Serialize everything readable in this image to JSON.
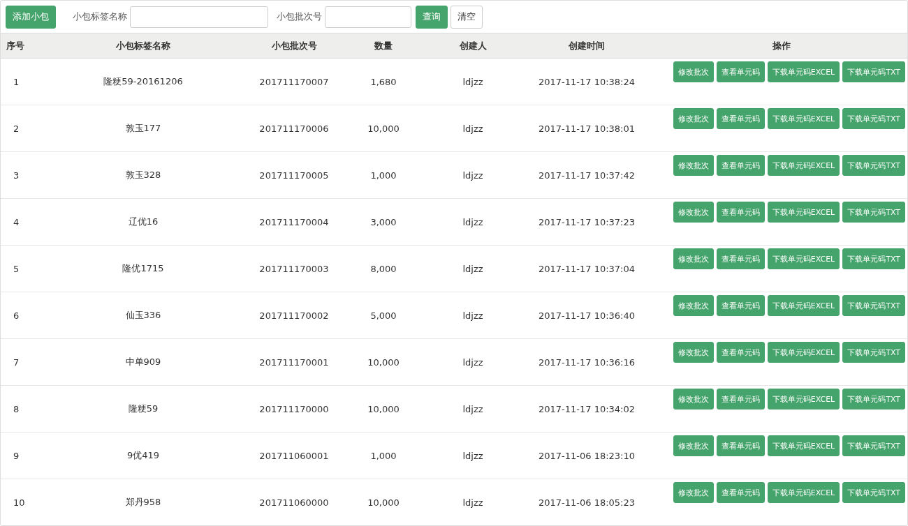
{
  "toolbar": {
    "add_button": "添加小包",
    "fields": [
      {
        "label": "小包标签名称"
      },
      {
        "label": "小包批次号"
      }
    ],
    "query_button": "查询",
    "clear_button": "清空"
  },
  "table": {
    "columns": [
      "序号",
      "小包标签名称",
      "小包批次号",
      "数量",
      "创建人",
      "创建时间",
      "操作"
    ],
    "rows": [
      {
        "index": "1",
        "name": "隆粳59-20161206",
        "batch": "201711170007",
        "quantity": "1,680",
        "creator": "ldjzz",
        "created": "2017-11-17 10:38:24",
        "actions": [
          "修改批次",
          "查看单元码",
          "下载单元码EXCEL",
          "下载单元码TXT"
        ]
      },
      {
        "index": "2",
        "name": "敦玉177",
        "batch": "201711170006",
        "quantity": "10,000",
        "creator": "ldjzz",
        "created": "2017-11-17 10:38:01",
        "actions": [
          "修改批次",
          "查看单元码",
          "下载单元码EXCEL",
          "下载单元码TXT"
        ]
      },
      {
        "index": "3",
        "name": "敦玉328",
        "batch": "201711170005",
        "quantity": "1,000",
        "creator": "ldjzz",
        "created": "2017-11-17 10:37:42",
        "actions": [
          "修改批次",
          "查看单元码",
          "下载单元码EXCEL",
          "下载单元码TXT"
        ]
      },
      {
        "index": "4",
        "name": "辽优16",
        "batch": "201711170004",
        "quantity": "3,000",
        "creator": "ldjzz",
        "created": "2017-11-17 10:37:23",
        "actions": [
          "修改批次",
          "查看单元码",
          "下载单元码EXCEL",
          "下载单元码TXT"
        ]
      },
      {
        "index": "5",
        "name": "隆优1715",
        "batch": "201711170003",
        "quantity": "8,000",
        "creator": "ldjzz",
        "created": "2017-11-17 10:37:04",
        "actions": [
          "修改批次",
          "查看单元码",
          "下载单元码EXCEL",
          "下载单元码TXT"
        ]
      },
      {
        "index": "6",
        "name": "仙玉336",
        "batch": "201711170002",
        "quantity": "5,000",
        "creator": "ldjzz",
        "created": "2017-11-17 10:36:40",
        "actions": [
          "修改批次",
          "查看单元码",
          "下载单元码EXCEL",
          "下载单元码TXT"
        ]
      },
      {
        "index": "7",
        "name": "中单909",
        "batch": "201711170001",
        "quantity": "10,000",
        "creator": "ldjzz",
        "created": "2017-11-17 10:36:16",
        "actions": [
          "修改批次",
          "查看单元码",
          "下载单元码EXCEL",
          "下载单元码TXT"
        ]
      },
      {
        "index": "8",
        "name": "隆粳59",
        "batch": "201711170000",
        "quantity": "10,000",
        "creator": "ldjzz",
        "created": "2017-11-17 10:34:02",
        "actions": [
          "修改批次",
          "查看单元码",
          "下载单元码EXCEL",
          "下载单元码TXT"
        ]
      },
      {
        "index": "9",
        "name": "9优419",
        "batch": "201711060001",
        "quantity": "1,000",
        "creator": "ldjzz",
        "created": "2017-11-06 18:23:10",
        "actions": [
          "修改批次",
          "查看单元码",
          "下载单元码EXCEL",
          "下载单元码TXT"
        ]
      },
      {
        "index": "10",
        "name": "郑丹958",
        "batch": "201711060000",
        "quantity": "10,000",
        "creator": "ldjzz",
        "created": "2017-11-06 18:05:23",
        "actions": [
          "修改批次",
          "查看单元码",
          "下载单元码EXCEL",
          "下载单元码TXT"
        ]
      }
    ]
  }
}
